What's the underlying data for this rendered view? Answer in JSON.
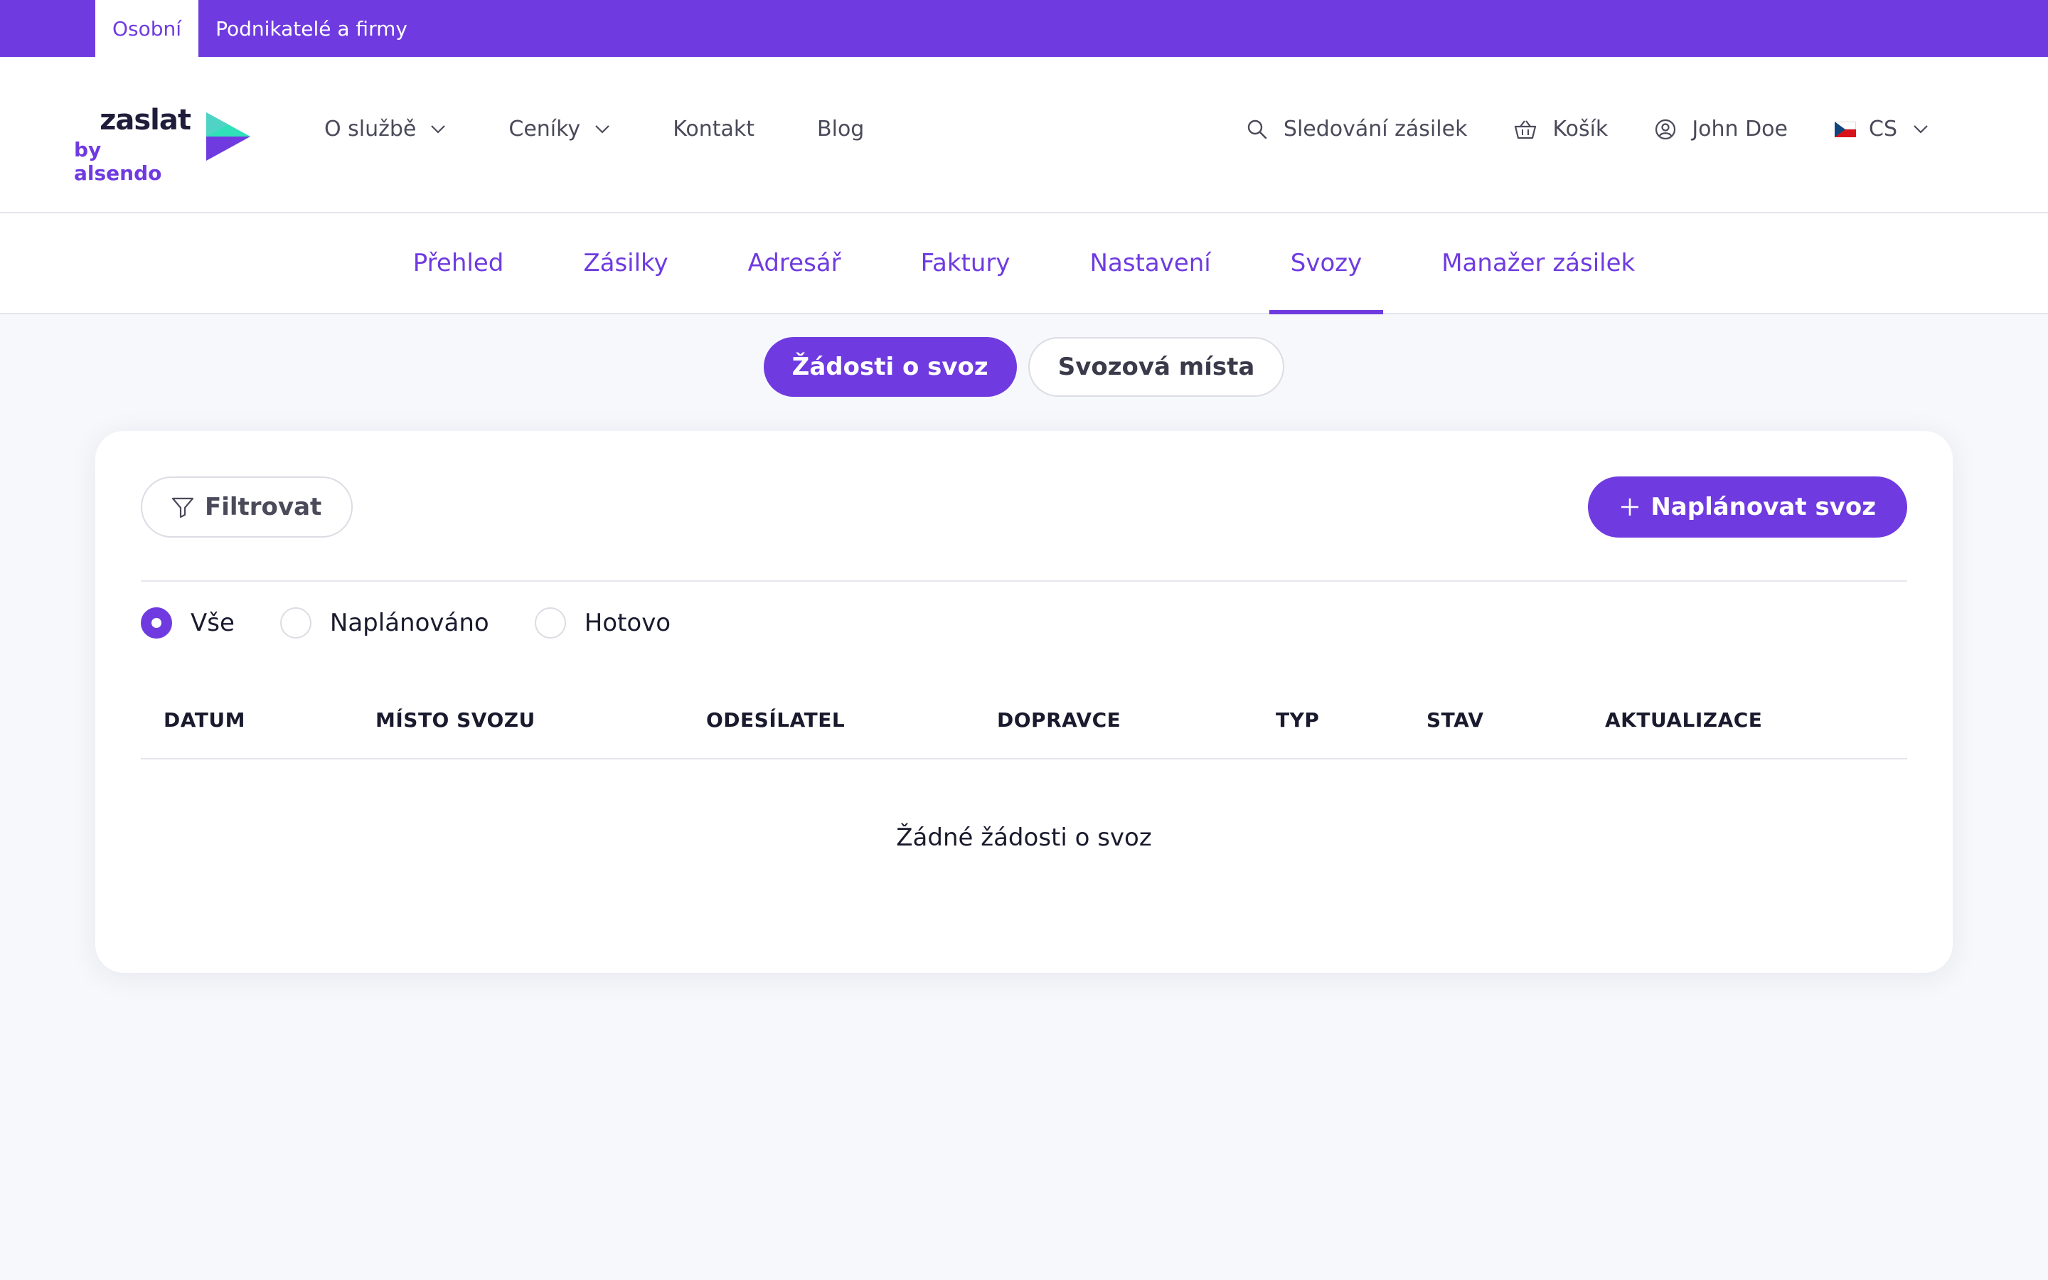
{
  "audience_tabs": [
    {
      "label": "Osobní",
      "active": true
    },
    {
      "label": "Podnikatelé a firmy",
      "active": false
    }
  ],
  "logo": {
    "word": "zaslat",
    "sub": "by alsendo"
  },
  "main_nav": [
    {
      "label": "O službě",
      "has_dropdown": true
    },
    {
      "label": "Ceníky",
      "has_dropdown": true
    },
    {
      "label": "Kontakt",
      "has_dropdown": false
    },
    {
      "label": "Blog",
      "has_dropdown": false
    }
  ],
  "right_nav": {
    "tracking": "Sledování zásilek",
    "cart": "Košík",
    "user": "John Doe",
    "language": "CS"
  },
  "account_tabs": [
    {
      "label": "Přehled",
      "active": false
    },
    {
      "label": "Zásilky",
      "active": false
    },
    {
      "label": "Adresář",
      "active": false
    },
    {
      "label": "Faktury",
      "active": false
    },
    {
      "label": "Nastavení",
      "active": false
    },
    {
      "label": "Svozy",
      "active": true
    },
    {
      "label": "Manažer zásilek",
      "active": false
    }
  ],
  "pickup_tabs": [
    {
      "label": "Žádosti o svoz",
      "active": true
    },
    {
      "label": "Svozová místa",
      "active": false
    }
  ],
  "toolbar": {
    "filter_label": "Filtrovat",
    "plan_label": "Naplánovat svoz"
  },
  "status_filter": [
    {
      "label": "Vše",
      "selected": true
    },
    {
      "label": "Naplánováno",
      "selected": false
    },
    {
      "label": "Hotovo",
      "selected": false
    }
  ],
  "table": {
    "columns": [
      "DATUM",
      "MÍSTO SVOZU",
      "ODESÍLATEL",
      "DOPRAVCE",
      "TYP",
      "STAV",
      "AKTUALIZACE"
    ],
    "empty_message": "Žádné žádosti o svoz"
  },
  "colors": {
    "brand": "#6f3be0",
    "logo_dark": "#1f1d3a",
    "logo_teal": "#2fe0b8"
  }
}
